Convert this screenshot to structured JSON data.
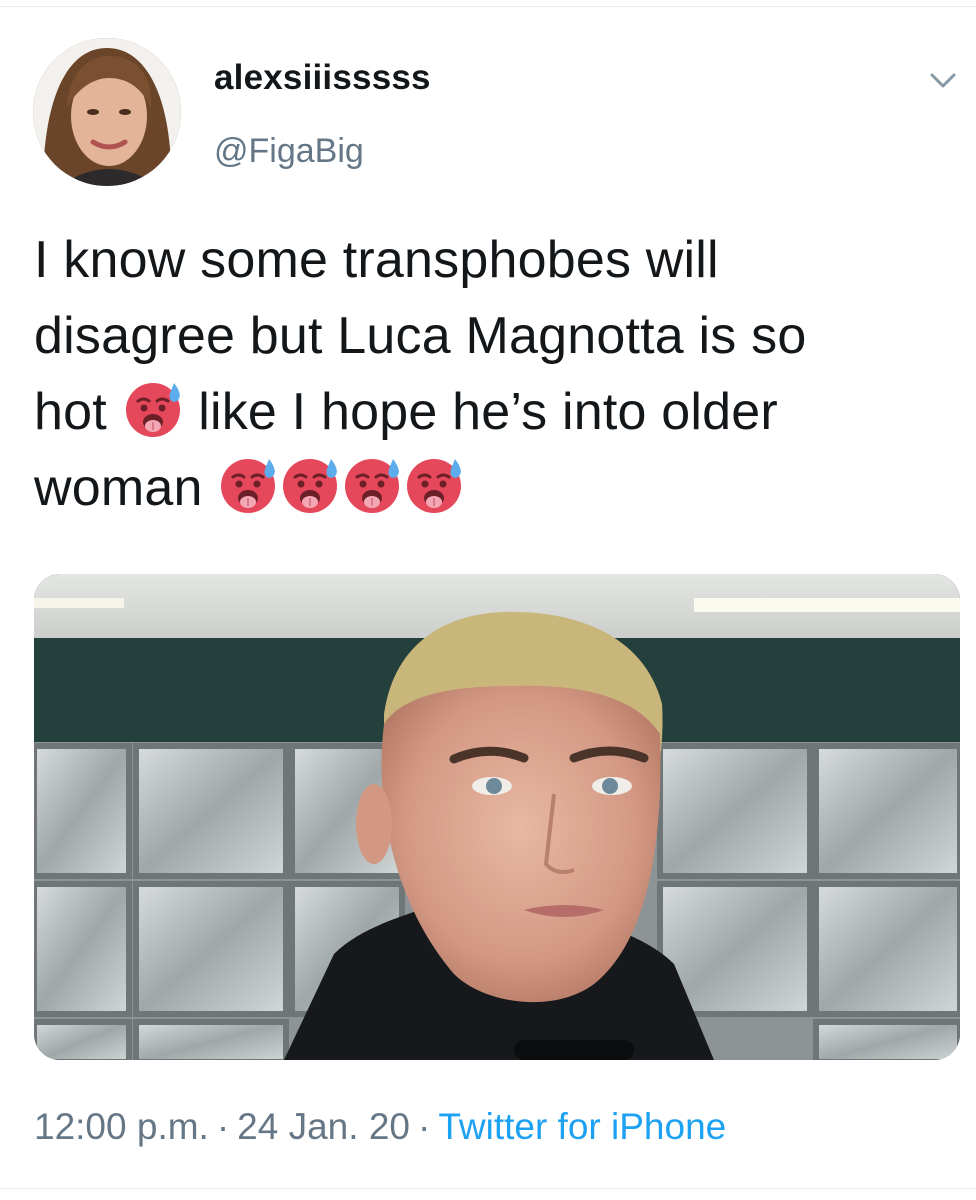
{
  "tweet": {
    "author": {
      "display_name": "alexsiiisssss",
      "handle": "@FigaBig"
    },
    "text_parts": {
      "line1": "I know some transphobes will",
      "line2": "disagree but Luca Magnotta is so",
      "line3a": "hot",
      "line3b": "like I hope he’s into older",
      "line4": "woman"
    },
    "emoji_name": "hot-face-emoji",
    "meta": {
      "time": "12:00 p.m.",
      "separator": "·",
      "date": "24 Jan. 20",
      "source": "Twitter for iPhone"
    }
  },
  "colors": {
    "text": "#14171a",
    "secondary": "#657786",
    "link": "#1da1f2",
    "divider": "#e6ecf0"
  },
  "icons": {
    "more": "chevron-down-icon"
  }
}
